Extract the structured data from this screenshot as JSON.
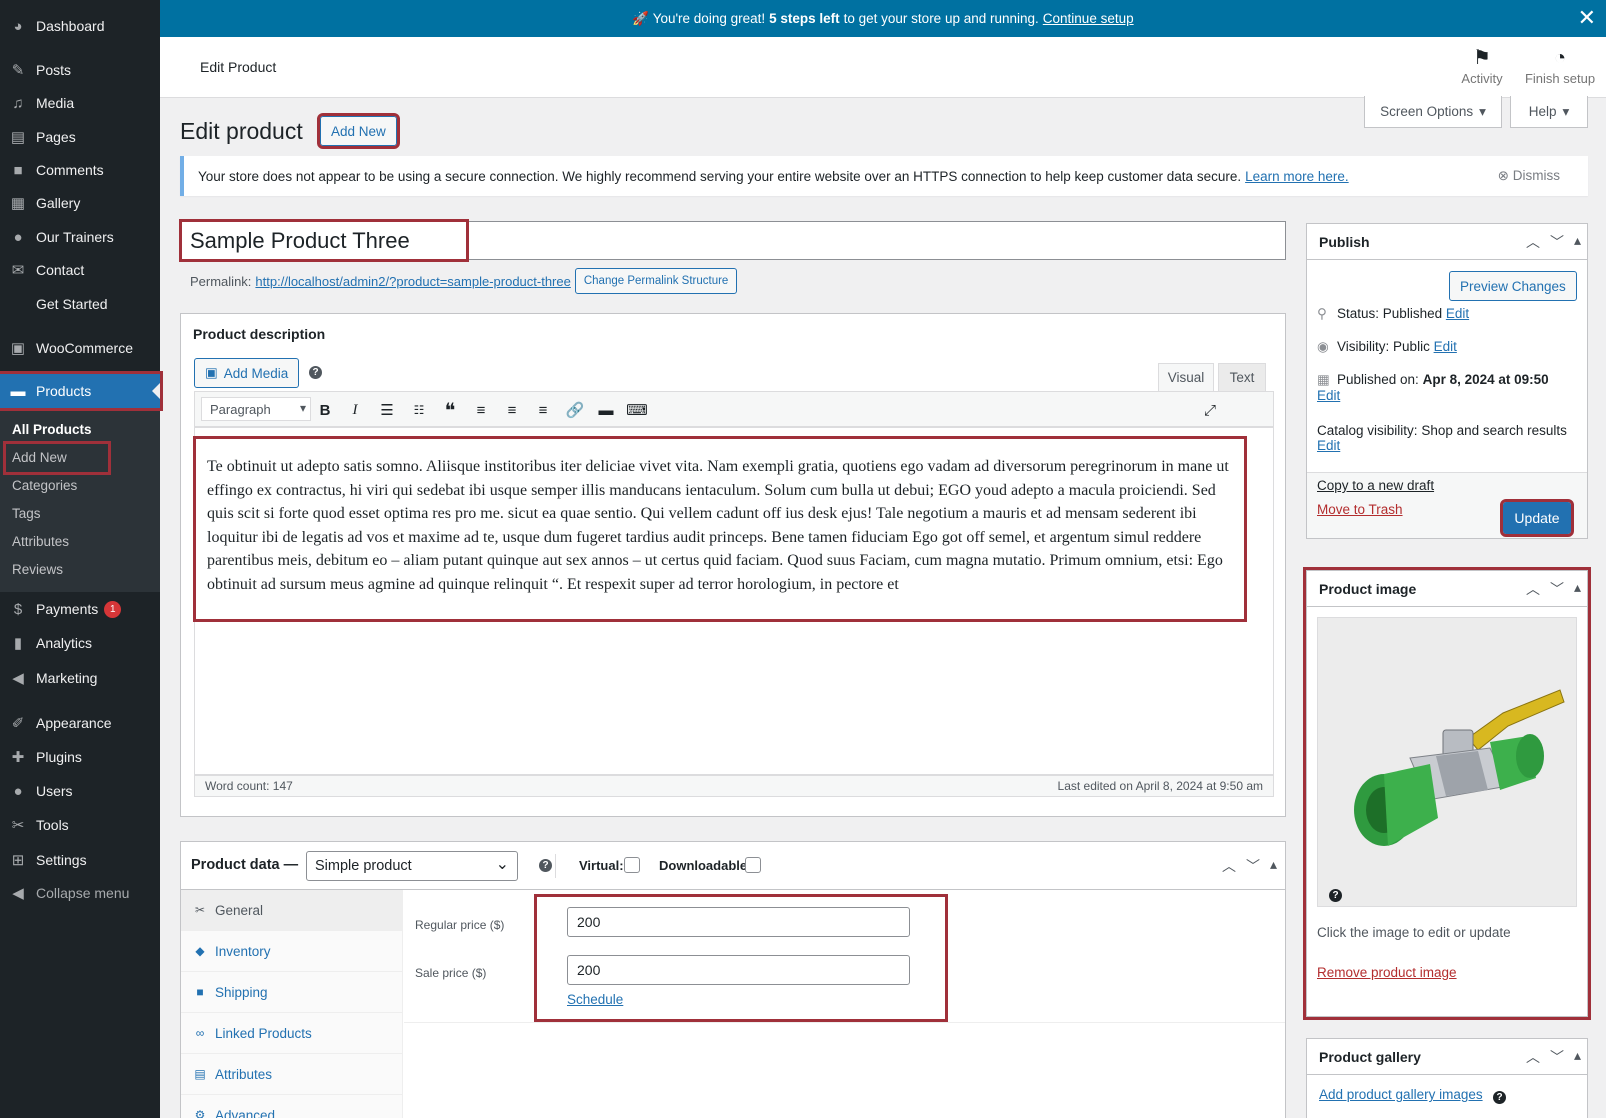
{
  "sidebar": {
    "items": [
      {
        "label": "Dashboard",
        "icon": "dashboard-icon"
      },
      {
        "label": "Posts",
        "icon": "pin-icon"
      },
      {
        "label": "Media",
        "icon": "media-icon"
      },
      {
        "label": "Pages",
        "icon": "pages-icon"
      },
      {
        "label": "Comments",
        "icon": "comments-icon"
      },
      {
        "label": "Gallery",
        "icon": "gallery-icon"
      },
      {
        "label": "Our Trainers",
        "icon": "groups-icon"
      },
      {
        "label": "Contact",
        "icon": "mail-icon"
      },
      {
        "label": "Get Started",
        "icon": ""
      },
      {
        "label": "WooCommerce",
        "icon": "woo-icon"
      },
      {
        "label": "Products",
        "icon": "archive-icon"
      },
      {
        "label": "Payments",
        "icon": "payments-icon",
        "badge": "1"
      },
      {
        "label": "Analytics",
        "icon": "chart-icon"
      },
      {
        "label": "Marketing",
        "icon": "megaphone-icon"
      },
      {
        "label": "Appearance",
        "icon": "brush-icon"
      },
      {
        "label": "Plugins",
        "icon": "plugin-icon"
      },
      {
        "label": "Users",
        "icon": "user-icon"
      },
      {
        "label": "Tools",
        "icon": "wrench-icon"
      },
      {
        "label": "Settings",
        "icon": "settings-icon"
      },
      {
        "label": "Collapse menu",
        "icon": "collapse-icon"
      }
    ],
    "submenu": [
      "All Products",
      "Add New",
      "Categories",
      "Tags",
      "Attributes",
      "Reviews"
    ]
  },
  "banner": {
    "prefix": "🚀 You're doing great!",
    "bold": "5 steps left",
    "suffix": "to get your store up and running.",
    "link": "Continue setup"
  },
  "header": {
    "title": "Edit Product",
    "activity": "Activity",
    "finish_setup": "Finish setup"
  },
  "screen_options": "Screen Options",
  "help": "Help",
  "page": {
    "title": "Edit product",
    "add_new": "Add New"
  },
  "notice": {
    "text": "Your store does not appear to be using a secure connection. We highly recommend serving your entire website over an HTTPS connection to help keep customer data secure.",
    "link": "Learn more here.",
    "dismiss": "Dismiss"
  },
  "product": {
    "title": "Sample Product Three",
    "permalink_label": "Permalink:",
    "permalink_url": "http://localhost/admin2/?product=sample-product-three",
    "change_permalink": "Change Permalink Structure"
  },
  "description": {
    "title": "Product description",
    "add_media": "Add Media",
    "tab_visual": "Visual",
    "tab_text": "Text",
    "format": "Paragraph",
    "body": "Te obtinuit ut adepto satis somno. Aliisque institoribus iter deliciae vivet vita. Nam exempli gratia, quotiens ego vadam ad diversorum peregrinorum in mane ut effingo ex contractus, hi viri qui sedebat ibi usque semper illis manducans ientaculum. Solum cum bulla ut debui; EGO youd adepto a macula proiciendi. Sed quis scit si forte quod esset optima res pro me. sicut ea quae sentio. Qui vellem cadunt off ius desk ejus! Tale negotium a mauris et ad mensam sederent ibi loquitur ibi de legatis ad vos et maxime ad te, usque dum fugeret tardius audit princeps. Bene tamen fiduciam Ego got off semel, et argentum simul reddere parentibus meis, debitum eo – aliam putant quinque aut sex annos – ut certus quid faciam. Quod suus Faciam, cum magna mutatio. Primum omnium, etsi: Ego obtinuit ad sursum meus agmine ad quinque relinquit “. Et respexit super ad terror horologium, in pectore et",
    "word_count": "Word count: 147",
    "last_edited": "Last edited on April 8, 2024 at 9:50 am"
  },
  "product_data": {
    "label": "Product data —",
    "type": "Simple product",
    "virtual": "Virtual:",
    "downloadable": "Downloadable:",
    "tabs": [
      {
        "label": "General",
        "icon": "wrench-icon"
      },
      {
        "label": "Inventory",
        "icon": "tag-icon"
      },
      {
        "label": "Shipping",
        "icon": "truck-icon"
      },
      {
        "label": "Linked Products",
        "icon": "link-icon"
      },
      {
        "label": "Attributes",
        "icon": "list-icon"
      },
      {
        "label": "Advanced",
        "icon": "gear-icon"
      }
    ],
    "regular_price_label": "Regular price ($)",
    "regular_price": "200",
    "sale_price_label": "Sale price ($)",
    "sale_price": "200",
    "schedule": "Schedule"
  },
  "publish": {
    "title": "Publish",
    "preview": "Preview Changes",
    "status_label": "Status:",
    "status": "Published",
    "visibility_label": "Visibility:",
    "visibility": "Public",
    "published_on_label": "Published on:",
    "published_on": "Apr 8, 2024 at 09:50",
    "catalog_label": "Catalog visibility:",
    "catalog": "Shop and search results",
    "edit": "Edit",
    "copy_draft": "Copy to a new draft",
    "trash": "Move to Trash",
    "update": "Update"
  },
  "product_image": {
    "title": "Product image",
    "hint": "Click the image to edit or update",
    "remove": "Remove product image"
  },
  "product_gallery": {
    "title": "Product gallery",
    "add": "Add product gallery images"
  },
  "colors": {
    "accent": "#2271b1",
    "banner": "#0071a1",
    "sidebar": "#1d2327",
    "highlight": "#a0303a"
  }
}
